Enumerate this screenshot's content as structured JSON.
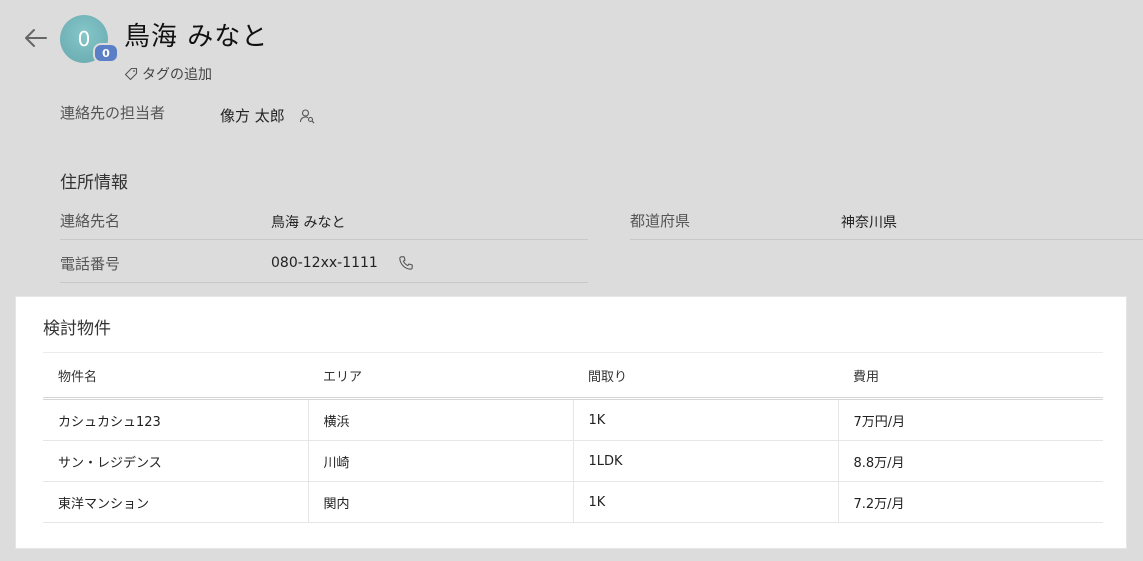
{
  "contact": {
    "avatar_initial": "0",
    "avatar_badge": "0",
    "name": "鳥海 みなと",
    "add_tag_label": "タグの追加"
  },
  "owner": {
    "label": "連絡先の担当者",
    "value": "像方 太郎"
  },
  "address": {
    "section_title": "住所情報",
    "contact_name_label": "連絡先名",
    "contact_name_value": "鳥海 みなと",
    "prefecture_label": "都道府県",
    "prefecture_value": "神奈川県",
    "phone_label": "電話番号",
    "phone_value": "080-12xx-1111"
  },
  "properties": {
    "title": "検討物件",
    "columns": [
      "物件名",
      "エリア",
      "間取り",
      "費用"
    ],
    "rows": [
      [
        "カシュカシュ123",
        "横浜",
        "1K",
        "7万円/月"
      ],
      [
        "サン・レジデンス",
        "川崎",
        "1LDK",
        "8.8万/月"
      ],
      [
        "東洋マンション",
        "関内",
        "1K",
        "7.2万/月"
      ]
    ]
  },
  "icons": {
    "back": "arrow-left-icon",
    "tag": "tag-icon",
    "user": "user-search-icon",
    "phone": "phone-icon"
  }
}
